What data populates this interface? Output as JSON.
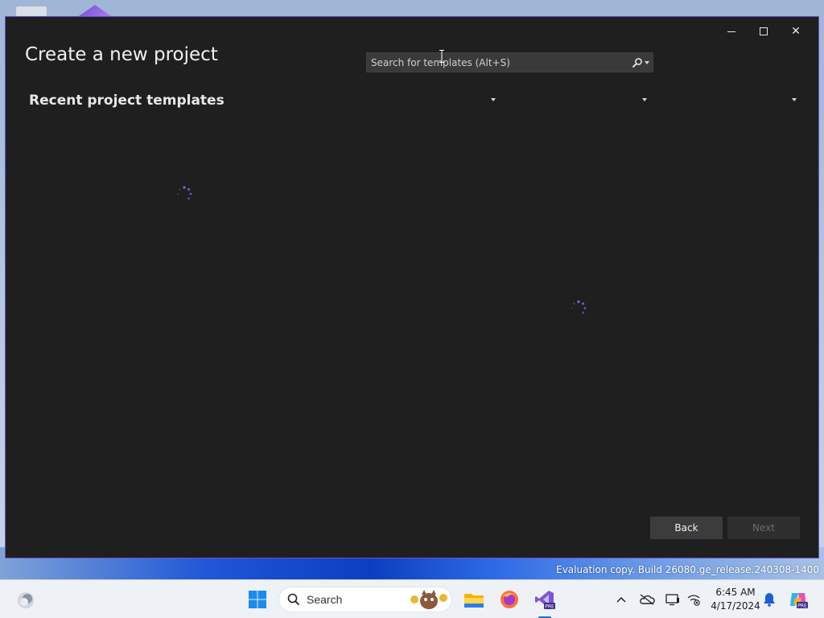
{
  "window": {
    "title": "Create a new project",
    "section_heading": "Recent project templates",
    "search": {
      "placeholder": "Search for templates (Alt+S)"
    },
    "buttons": {
      "back": "Back",
      "next": "Next"
    },
    "controls": {
      "minimize": "minimize",
      "maximize": "maximize",
      "close": "close"
    }
  },
  "desktop": {
    "evaluation_text": "Evaluation copy. Build 26080.ge_release.240308-1400"
  },
  "taskbar": {
    "search_label": "Search",
    "apps": [
      "widgets-icon",
      "start-icon",
      "file-explorer-icon",
      "firefox-icon",
      "visual-studio-preview-icon"
    ],
    "tray": [
      "chevron-up-icon",
      "onedrive-icon",
      "display-icon",
      "network-icon",
      "notification-bell-icon",
      "copilot-icon"
    ],
    "clock_time": "6:45 AM",
    "clock_date": "4/17/2024"
  },
  "colors": {
    "window_bg": "#1f1f1f",
    "accent": "#6b4fc8",
    "spinner": "#7a6ad6"
  }
}
